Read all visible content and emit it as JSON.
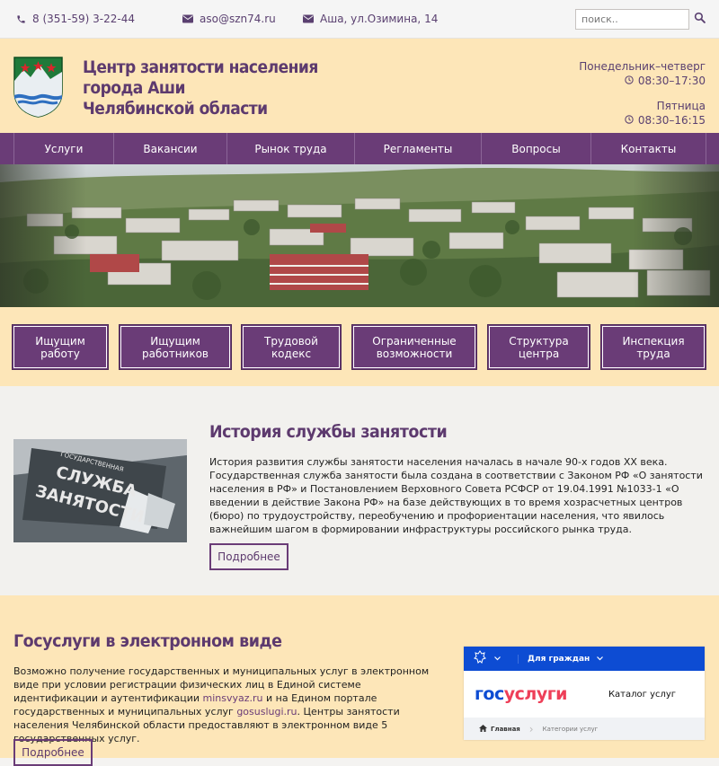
{
  "topbar": {
    "phone": "8 (351-59) 3-22-44",
    "email": "aso@szn74.ru",
    "address": "Аша, ул.Озимина, 14",
    "search_placeholder": "поиск.."
  },
  "header": {
    "title_line1": "Центр занятости населения",
    "title_line2": "города Аши",
    "title_line3": "Челябинской области",
    "hours_weekdays_label": "Понедельник–четверг",
    "hours_weekdays": "08:30–17:30",
    "hours_friday_label": "Пятница",
    "hours_friday": "08:30–16:15"
  },
  "nav": {
    "items": [
      {
        "label": "Услуги"
      },
      {
        "label": "Вакансии"
      },
      {
        "label": "Рынок труда"
      },
      {
        "label": "Регламенты"
      },
      {
        "label": "Вопросы"
      },
      {
        "label": "Контакты"
      }
    ]
  },
  "quick": {
    "items": [
      {
        "line1": "Ищущим",
        "line2": "работу"
      },
      {
        "line1": "Ищущим",
        "line2": "работников"
      },
      {
        "line1": "Трудовой",
        "line2": "кодекс"
      },
      {
        "line1": "Ограниченные",
        "line2": "возможности"
      },
      {
        "line1": "Структура",
        "line2": "центра"
      },
      {
        "line1": "Инспекция",
        "line2": "труда"
      }
    ]
  },
  "history": {
    "title": "История службы занятости",
    "text": "История развития службы занятости населения началась в начале 90-х годов XX века. Государственная служба занятости была создана в соответствии с Законом РФ «О занятости населения в РФ» и Постановлением Верховного Совета РСФСР от 19.04.1991 №1033-1 «О введении в действие Закона РФ» на базе действующих в то время хозрасчетных центров (бюро) по трудоустройству, переобучению и профориентации населения, что явилось важнейшим шагом в формировании инфраструктуры российского рынка труда.",
    "more_label": "Подробнее",
    "photo_text_1": "ГОСУДАРСТВЕННАЯ",
    "photo_text_2": "СЛУЖБА",
    "photo_text_3": "ЗАНЯТОСТИ"
  },
  "gos": {
    "title": "Госуслуги в электронном виде",
    "text_part1": "Возможно получение государственных и муниципальных услуг в электронном виде при условии регистрации физических лиц в Единой системе идентификации и аутентификации ",
    "link1": "minsvyaz.ru",
    "text_part2": " и на Едином портале государственных и муниципальных услуг ",
    "link2": "gosuslugi.ru",
    "text_part3": ". Центры занятости населения Челябинской области предоставляют в электронном виде 5 государственных услуг.",
    "more_label": "Подробнее",
    "card": {
      "bar_label": "Для граждан",
      "logo_part1": "гос",
      "logo_part2": "услуги",
      "catalog": "Каталог услуг",
      "crumb_home": "Главная",
      "crumb_categories": "Категории услуг"
    }
  },
  "colors": {
    "purple": "#6a3c77",
    "cream": "#fde6b8",
    "gos_blue": "#0d4cd3",
    "gos_red": "#ee3f58"
  }
}
